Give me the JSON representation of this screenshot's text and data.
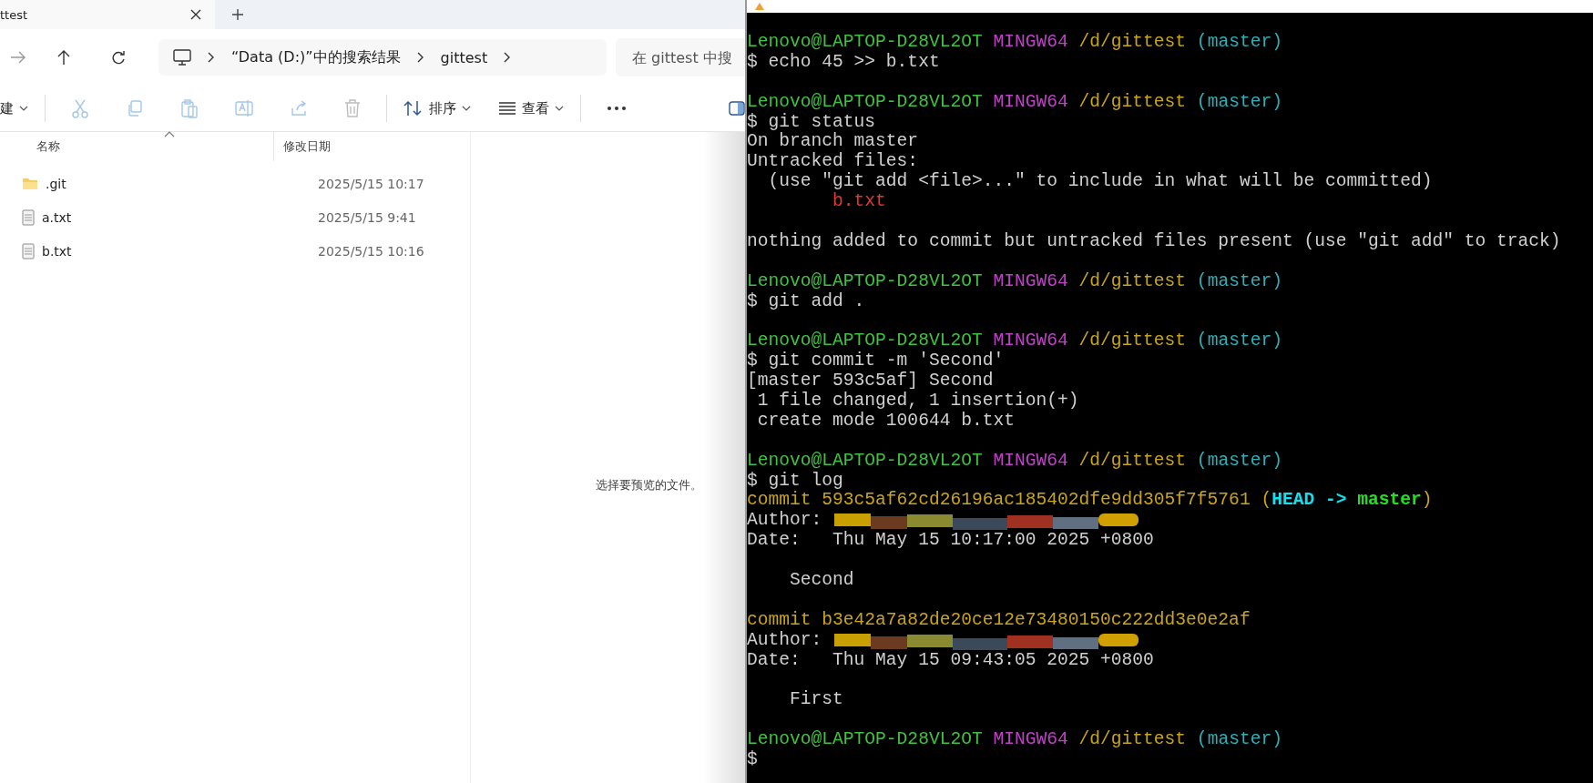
{
  "explorer": {
    "tab": {
      "title": "ttest"
    },
    "address": {
      "crumbs": [
        "“Data (D:)”中的搜索结果",
        "gittest"
      ]
    },
    "search": {
      "placeholder": "在 gittest 中搜"
    },
    "toolbar": {
      "new_label": "建",
      "actions": [
        {
          "kind": "cut",
          "disabled": true
        },
        {
          "kind": "copy",
          "disabled": true
        },
        {
          "kind": "paste",
          "disabled": true
        },
        {
          "kind": "rename",
          "disabled": true
        },
        {
          "kind": "share",
          "disabled": true
        },
        {
          "kind": "delete",
          "disabled": true
        }
      ],
      "sort_label": "排序",
      "view_label": "查看"
    },
    "columns": [
      "名称",
      "修改日期"
    ],
    "files": [
      {
        "kind": "folder",
        "name": ".git",
        "modified": "2025/5/15 10:17"
      },
      {
        "kind": "text",
        "name": "a.txt",
        "modified": "2025/5/15 9:41"
      },
      {
        "kind": "text",
        "name": "b.txt",
        "modified": "2025/5/15 10:16"
      }
    ],
    "preview_hint": "选择要预览的文件。"
  },
  "terminal": {
    "lines": [
      {
        "segments": [
          {
            "kind": "user",
            "text": "Lenovo@LAPTOP-D28VL2OT"
          },
          {
            "kind": "system",
            "text": " MINGW64"
          },
          {
            "kind": "path",
            "text": " /d/gittest"
          },
          {
            "kind": "branch",
            "text": " (master)"
          }
        ]
      },
      {
        "segments": [
          {
            "kind": "plain",
            "text": "$ echo 45 >> b.txt"
          }
        ]
      },
      {
        "kind": "blank"
      },
      {
        "segments": [
          {
            "kind": "user",
            "text": "Lenovo@LAPTOP-D28VL2OT"
          },
          {
            "kind": "system",
            "text": " MINGW64"
          },
          {
            "kind": "path",
            "text": " /d/gittest"
          },
          {
            "kind": "branch",
            "text": " (master)"
          }
        ]
      },
      {
        "segments": [
          {
            "kind": "plain",
            "text": "$ git status"
          }
        ]
      },
      {
        "segments": [
          {
            "kind": "plain",
            "text": "On branch master"
          }
        ]
      },
      {
        "segments": [
          {
            "kind": "plain",
            "text": "Untracked files:"
          }
        ]
      },
      {
        "segments": [
          {
            "kind": "plain",
            "text": "  (use \"git add <file>...\" to include in what will be committed)"
          }
        ]
      },
      {
        "segments": [
          {
            "kind": "untracked",
            "text": "        b.txt"
          }
        ]
      },
      {
        "kind": "blank"
      },
      {
        "segments": [
          {
            "kind": "plain",
            "text": "nothing added to commit but untracked files present (use \"git add\" to track)"
          }
        ]
      },
      {
        "kind": "blank"
      },
      {
        "segments": [
          {
            "kind": "user",
            "text": "Lenovo@LAPTOP-D28VL2OT"
          },
          {
            "kind": "system",
            "text": " MINGW64"
          },
          {
            "kind": "path",
            "text": " /d/gittest"
          },
          {
            "kind": "branch",
            "text": " (master)"
          }
        ]
      },
      {
        "segments": [
          {
            "kind": "plain",
            "text": "$ git add ."
          }
        ]
      },
      {
        "kind": "blank"
      },
      {
        "segments": [
          {
            "kind": "user",
            "text": "Lenovo@LAPTOP-D28VL2OT"
          },
          {
            "kind": "system",
            "text": " MINGW64"
          },
          {
            "kind": "path",
            "text": " /d/gittest"
          },
          {
            "kind": "branch",
            "text": " (master)"
          }
        ]
      },
      {
        "segments": [
          {
            "kind": "plain",
            "text": "$ git commit -m 'Second'"
          }
        ]
      },
      {
        "segments": [
          {
            "kind": "plain",
            "text": "[master 593c5af] Second"
          }
        ]
      },
      {
        "segments": [
          {
            "kind": "plain",
            "text": " 1 file changed, 1 insertion(+)"
          }
        ]
      },
      {
        "segments": [
          {
            "kind": "plain",
            "text": " create mode 100644 b.txt"
          }
        ]
      },
      {
        "kind": "blank"
      },
      {
        "segments": [
          {
            "kind": "user",
            "text": "Lenovo@LAPTOP-D28VL2OT"
          },
          {
            "kind": "system",
            "text": " MINGW64"
          },
          {
            "kind": "path",
            "text": " /d/gittest"
          },
          {
            "kind": "branch",
            "text": " (master)"
          }
        ]
      },
      {
        "segments": [
          {
            "kind": "plain",
            "text": "$ git log"
          }
        ]
      },
      {
        "segments": [
          {
            "kind": "commit",
            "text": "commit 593c5af62cd26196ac185402dfe9dd305f7f5761 ("
          },
          {
            "kind": "head",
            "text": "HEAD ->"
          },
          {
            "kind": "ref",
            "text": " master"
          },
          {
            "kind": "commit",
            "text": ")"
          }
        ]
      },
      {
        "segments": [
          {
            "kind": "plain",
            "text": "Author: "
          }
        ],
        "redacted": true
      },
      {
        "segments": [
          {
            "kind": "plain",
            "text": "Date:   Thu May 15 10:17:00 2025 +0800"
          }
        ]
      },
      {
        "kind": "blank"
      },
      {
        "segments": [
          {
            "kind": "plain",
            "text": "    Second"
          }
        ]
      },
      {
        "kind": "blank"
      },
      {
        "segments": [
          {
            "kind": "commit",
            "text": "commit b3e42a7a82de20ce12e73480150c222dd3e0e2af"
          }
        ]
      },
      {
        "segments": [
          {
            "kind": "plain",
            "text": "Author: "
          }
        ],
        "redacted": true
      },
      {
        "segments": [
          {
            "kind": "plain",
            "text": "Date:   Thu May 15 09:43:05 2025 +0800"
          }
        ]
      },
      {
        "kind": "blank"
      },
      {
        "segments": [
          {
            "kind": "plain",
            "text": "    First"
          }
        ]
      },
      {
        "kind": "blank"
      },
      {
        "segments": [
          {
            "kind": "user",
            "text": "Lenovo@LAPTOP-D28VL2OT"
          },
          {
            "kind": "system",
            "text": " MINGW64"
          },
          {
            "kind": "path",
            "text": " /d/gittest"
          },
          {
            "kind": "branch",
            "text": " (master)"
          }
        ]
      },
      {
        "segments": [
          {
            "kind": "plain",
            "text": "$"
          }
        ]
      }
    ]
  }
}
